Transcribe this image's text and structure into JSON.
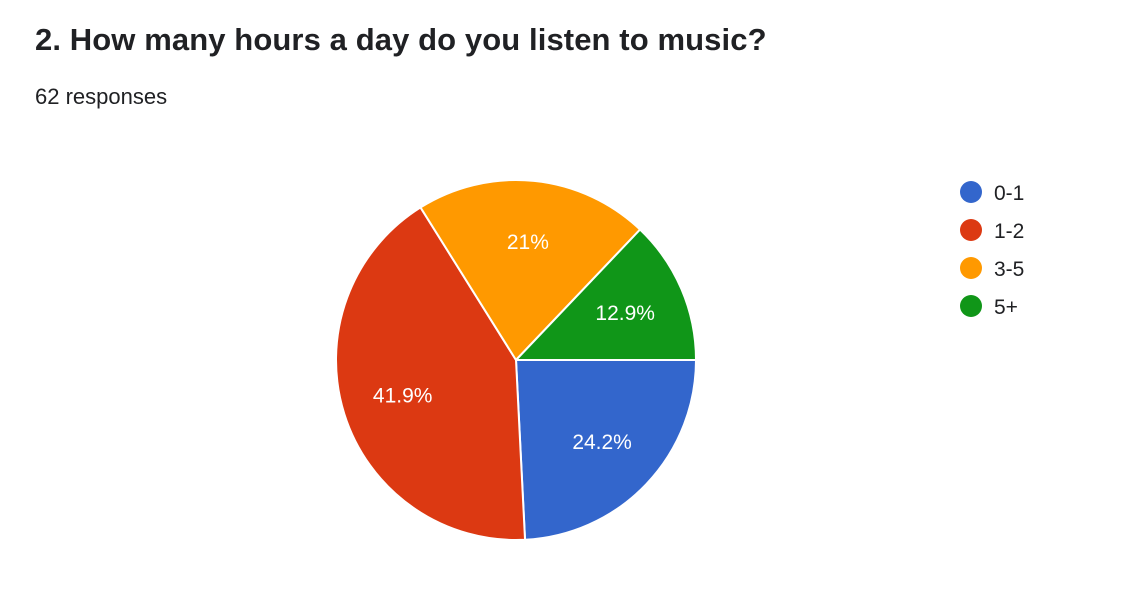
{
  "question": {
    "title": "2. How many hours a day do you listen to music?",
    "responses": "62 responses"
  },
  "chart_data": {
    "type": "pie",
    "title": "2. How many hours a day do you listen to music?",
    "total_responses": 62,
    "legend_position": "right",
    "slices": [
      {
        "label": "0-1",
        "value": 24.2,
        "display": "24.2%",
        "color": "#3366cc"
      },
      {
        "label": "1-2",
        "value": 41.9,
        "display": "41.9%",
        "color": "#dc3912"
      },
      {
        "label": "3-5",
        "value": 21.0,
        "display": "21%",
        "color": "#ff9900"
      },
      {
        "label": "5+",
        "value": 12.9,
        "display": "12.9%",
        "color": "#109618"
      }
    ]
  }
}
